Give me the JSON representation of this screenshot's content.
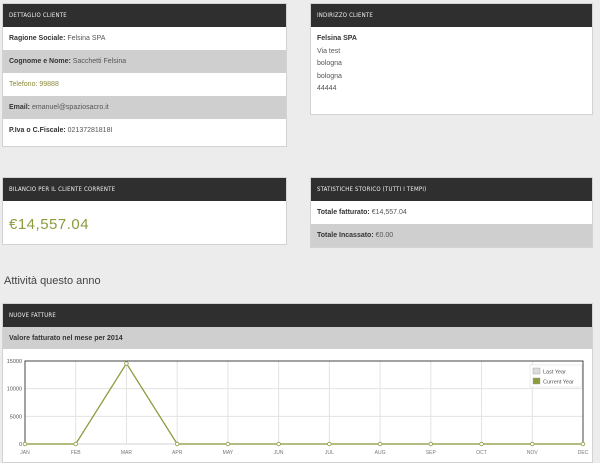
{
  "customer_detail": {
    "header": "DETTAGLIO CLIENTE",
    "rows": [
      {
        "label": "Ragione Sociale:",
        "value": "Felsina SPA"
      },
      {
        "label": "Cognome e Nome:",
        "value": "Sacchetti Felsina"
      },
      {
        "label": "Telefono:",
        "value": "99888"
      },
      {
        "label": "Email:",
        "value": "emanuel@spaziosacro.it"
      },
      {
        "label": "P.Iva o C.Fiscale:",
        "value": "02137281818I"
      }
    ]
  },
  "customer_address": {
    "header": "INDIRIZZO CLIENTE",
    "name": "Felsina SPA",
    "lines": [
      "Via test",
      "bologna",
      "bologna",
      "44444"
    ]
  },
  "balance": {
    "header": "BILANCIO PER IL CLIENTE CORRENTE",
    "amount": "€14,557.04"
  },
  "history": {
    "header": "STATISTICHE STORICO (TUTTI I TEMPI)",
    "rows": [
      {
        "label": "Totale fatturato:",
        "value": "€14,557.04"
      },
      {
        "label": "Totale Incassato:",
        "value": "€0.00"
      }
    ]
  },
  "activity_title": "Attività questo anno",
  "invoices": {
    "header": "NUOVE FATTURE",
    "subheader": "Valore fatturato nel mese per 2014"
  },
  "colors": {
    "current_year": "#8e9a3e",
    "last_year": "#dcdcdc"
  },
  "chart_data": {
    "type": "line",
    "categories": [
      "JAN",
      "FEB",
      "MAR",
      "APR",
      "MAY",
      "JUN",
      "JUL",
      "AUG",
      "SEP",
      "OCT",
      "NOV",
      "DEC"
    ],
    "ylim": [
      0,
      15000
    ],
    "yticks": [
      "0",
      "5000",
      "10000",
      "15000"
    ],
    "legend_placement": "top-right",
    "series": [
      {
        "name": "Last Year",
        "values": [
          0,
          0,
          0,
          0,
          0,
          0,
          0,
          0,
          0,
          0,
          0,
          0
        ]
      },
      {
        "name": "Current Year",
        "values": [
          0,
          0,
          14557.04,
          0,
          0,
          0,
          0,
          0,
          0,
          0,
          0,
          0
        ]
      }
    ]
  }
}
